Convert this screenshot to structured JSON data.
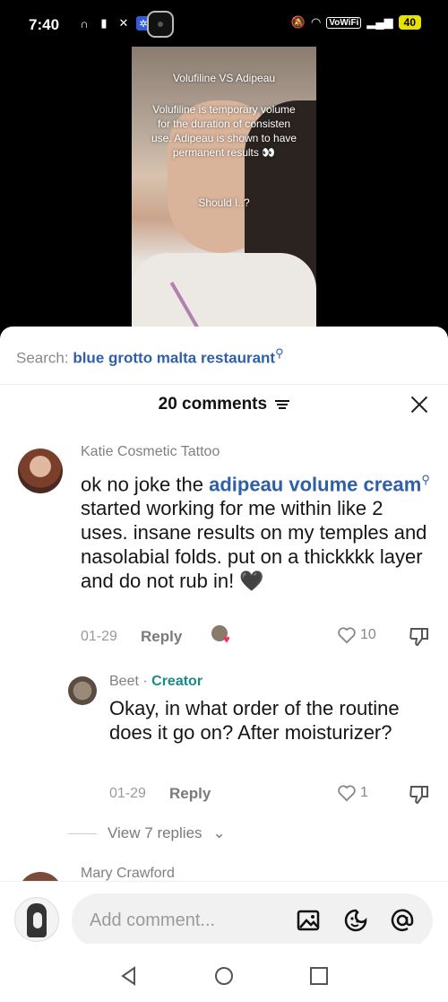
{
  "status_bar": {
    "time": "7:40",
    "vowifi": "VoWiFi",
    "battery": "40"
  },
  "video": {
    "title": "Volufiline VS Adipeau",
    "body": "Volufiline is temporary volume for the duration of consisten use. Adipeau is shown to have permanent results 👀",
    "question": "Should I..?"
  },
  "search": {
    "label": "Search:",
    "query": "blue grotto malta restaurant"
  },
  "comments_header": {
    "title": "20 comments"
  },
  "comments": [
    {
      "author": "Katie Cosmetic Tattoo",
      "text_before": "ok no joke the",
      "link": "adipeau volume cream",
      "text_after": "started working for me within like 2 uses. insane results on my temples and nasolabial folds. put on a thickkkk layer and do not rub in! 🖤",
      "date": "01-29",
      "reply_label": "Reply",
      "likes": "10"
    },
    {
      "author": "Beet",
      "author_badge": "Creator",
      "text": "Okay, in what order of the routine does it go on? After moisturizer?",
      "date": "01-29",
      "reply_label": "Reply",
      "likes": "1"
    }
  ],
  "view_replies": "View 7 replies",
  "next_author": "Mary Crawford",
  "input": {
    "placeholder": "Add comment..."
  },
  "icons": {
    "search_query": "search-icon",
    "sort": "sort-icon",
    "close": "close-icon",
    "like": "heart-icon",
    "dislike": "thumbs-down-icon",
    "image": "image-icon",
    "emoji": "emoji-icon",
    "mention": "at-icon"
  },
  "colors": {
    "link": "#2f5fa8",
    "creator": "#1a8a8a",
    "battery": "#e8e000"
  }
}
